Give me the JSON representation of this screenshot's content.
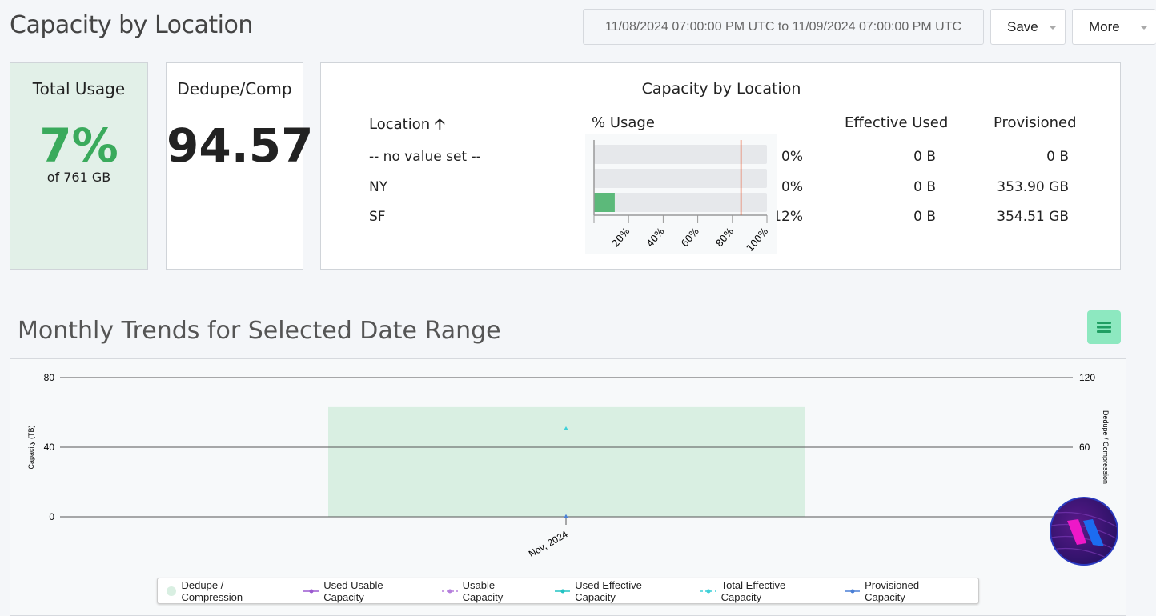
{
  "header": {
    "title": "Capacity by Location",
    "date_range": "11/08/2024 07:00:00 PM UTC to 11/09/2024 07:00:00 PM UTC",
    "save_label": "Save",
    "more_label": "More"
  },
  "total_usage": {
    "title": "Total Usage",
    "value": "7%",
    "sub": "of 761 GB",
    "color": "#3aaa5c"
  },
  "dedupe": {
    "title": "Dedupe/Comp",
    "value": "94.57"
  },
  "capacity_table": {
    "title": "Capacity by Location",
    "headers": {
      "location": "Location",
      "usage": "% Usage",
      "effective": "Effective Used",
      "provisioned": "Provisioned"
    },
    "rows": [
      {
        "location": "-- no value set --",
        "pct": 0,
        "usage": "0%",
        "effective": "0 B",
        "provisioned": "0 B"
      },
      {
        "location": "NY",
        "pct": 0,
        "usage": "0%",
        "effective": "0 B",
        "provisioned": "353.90 GB"
      },
      {
        "location": "SF",
        "pct": 12,
        "usage": "12%",
        "effective": "0 B",
        "provisioned": "354.51 GB"
      }
    ],
    "axis_ticks": [
      "20%",
      "40%",
      "60%",
      "80%",
      "100%"
    ],
    "threshold_pct": 85
  },
  "trends": {
    "title": "Monthly Trends for Selected Date Range"
  },
  "chart_data": {
    "type": "bar+line",
    "x": [
      "Nov, 2024"
    ],
    "ylabel": "Capacity (TB)",
    "y2label": "Dedupe / Compression",
    "ylim": [
      0,
      80
    ],
    "y2lim": [
      0,
      120
    ],
    "yticks": [
      "0",
      "40",
      "80"
    ],
    "y2ticks": [
      "60",
      "120"
    ],
    "grid": true,
    "legend": "bottom",
    "series": [
      {
        "name": "Dedupe / Compression",
        "axis": "right",
        "type": "bar",
        "values": [
          94.57
        ],
        "color": "#d9efe2"
      },
      {
        "name": "Used Usable Capacity",
        "type": "line",
        "values": [
          0
        ],
        "color": "#9b59d0"
      },
      {
        "name": "Usable Capacity",
        "type": "line",
        "dashed": true,
        "values": [
          0
        ],
        "color": "#b57fdc"
      },
      {
        "name": "Used Effective Capacity",
        "type": "line",
        "values": [
          0
        ],
        "color": "#22c3c3"
      },
      {
        "name": "Total Effective Capacity",
        "type": "line",
        "dashed": true,
        "values": [
          50.6
        ],
        "color": "#3fd0d8"
      },
      {
        "name": "Provisioned Capacity",
        "type": "line",
        "values": [
          0
        ],
        "color": "#4a7fd6"
      }
    ]
  }
}
